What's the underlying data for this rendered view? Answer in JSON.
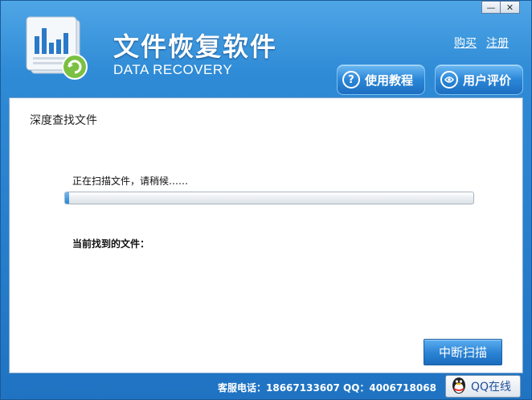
{
  "window": {
    "controls": {
      "minimize": "—",
      "close": "✕"
    }
  },
  "header": {
    "title": "文件恢复软件",
    "subtitle": "DATA RECOVERY",
    "links": {
      "buy": "购买",
      "register": "注册"
    },
    "buttons": {
      "help": {
        "label": "使用教程",
        "icon": "?"
      },
      "review": {
        "label": "用户评价"
      }
    }
  },
  "main": {
    "section_title": "深度查找文件",
    "scan_message": "正在扫描文件，请稍候……",
    "progress": 0.01,
    "found_label": "当前找到的文件：",
    "stop_button": "中断扫描"
  },
  "footer": {
    "support": "客服电话：18667133607  QQ：4006718068",
    "qq_button": "QQ在线"
  }
}
